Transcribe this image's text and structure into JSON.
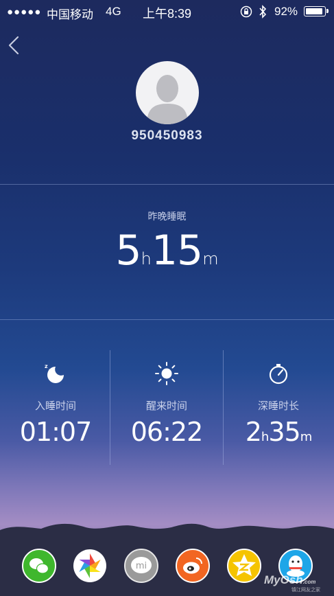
{
  "status_bar": {
    "signal_dots": "●●●●●",
    "carrier": "中国移动",
    "network": "4G",
    "time": "上午8:39",
    "battery_percent": "92%",
    "battery_level": 0.92
  },
  "profile": {
    "user_id": "950450983"
  },
  "summary": {
    "label": "昨晚睡眠",
    "hours": "5",
    "hours_unit": "h",
    "minutes": "15",
    "minutes_unit": "m"
  },
  "stats": [
    {
      "icon": "moon-zzz-icon",
      "label": "入睡时间",
      "value": "01:07"
    },
    {
      "icon": "sun-icon",
      "label": "醒来时间",
      "value": "06:22"
    },
    {
      "icon": "stopwatch-icon",
      "label": "深睡时长",
      "hours": "2",
      "hours_unit": "h",
      "minutes": "35",
      "minutes_unit": "m"
    }
  ],
  "share": [
    {
      "name": "wechat",
      "color": "#3fb72d"
    },
    {
      "name": "moments",
      "color": "#ffffff"
    },
    {
      "name": "miliao",
      "label": "mi",
      "color": "#9a9a9a"
    },
    {
      "name": "weibo",
      "color": "#f26622"
    },
    {
      "name": "qzone",
      "color": "#f5c400"
    },
    {
      "name": "qq",
      "color": "#1ea6e8"
    }
  ],
  "watermark": {
    "main": "MyOsh",
    "domain": ".com",
    "sub": "镇江网友之家"
  }
}
